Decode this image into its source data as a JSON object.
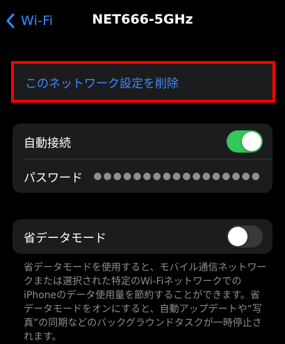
{
  "navbar": {
    "back_label": "Wi-Fi",
    "title": "NET666-5GHz"
  },
  "forget": {
    "label": "このネットワーク設定を削除"
  },
  "network_settings": {
    "auto_join_label": "自動接続",
    "auto_join_enabled": true,
    "password_label": "パスワード",
    "password_mask": "●●●●●●●●●●●●●●●●●"
  },
  "low_data": {
    "label": "省データモード",
    "enabled": false,
    "description": "省データモードを使用すると、モバイル通信ネットワークまたは選択された特定のWi-Fiネットワークでの iPhoneのデータ使用量を節約することができます。省データモードをオンにすると、自動アップデートや“写真”の同期などのバックグラウンドタスクが一時停止されます。"
  },
  "colors": {
    "accent": "#3c8bff",
    "toggle_on": "#34c759",
    "highlight_border": "#ff0000",
    "cell_background": "#1c1c1e"
  },
  "icons": {
    "back": "chevron-left-icon"
  }
}
